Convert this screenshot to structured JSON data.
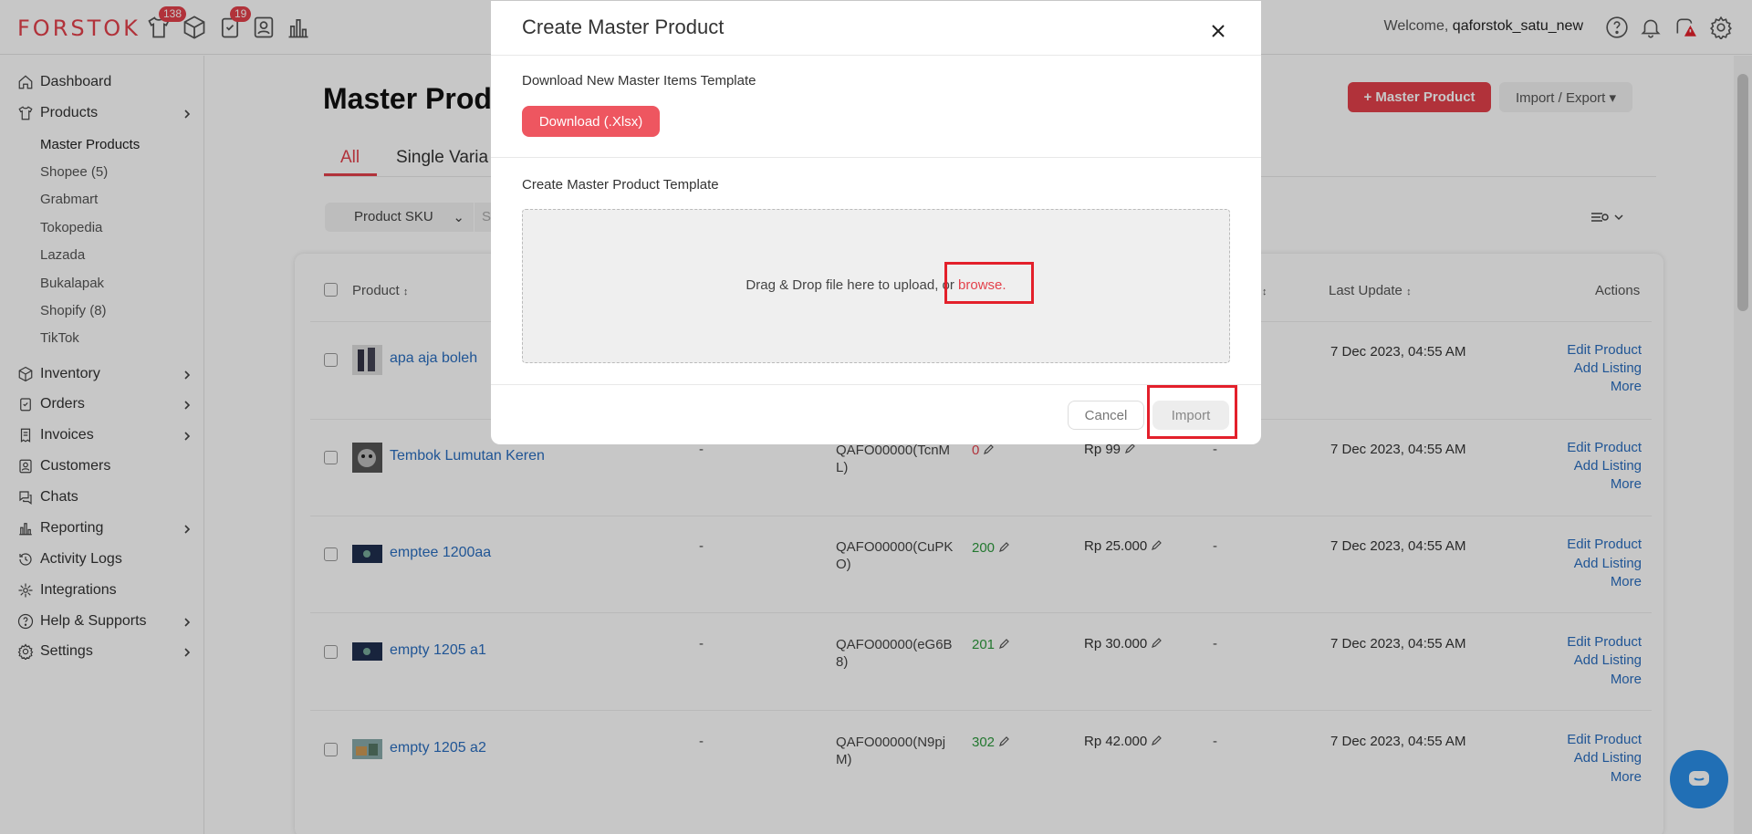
{
  "app": {
    "logo": "FORSTOK"
  },
  "topbar": {
    "badges": {
      "products": "138",
      "orders": "19"
    },
    "welcome_prefix": "Welcome, ",
    "username": "qaforstok_satu_new"
  },
  "sidebar": {
    "items": [
      {
        "label": "Dashboard",
        "icon": "home-icon"
      },
      {
        "label": "Products",
        "icon": "tshirt-icon"
      },
      {
        "label": "Inventory",
        "icon": "box-icon"
      },
      {
        "label": "Orders",
        "icon": "clipboard-icon"
      },
      {
        "label": "Invoices",
        "icon": "invoice-icon"
      },
      {
        "label": "Customers",
        "icon": "contact-icon"
      },
      {
        "label": "Chats",
        "icon": "chat-icon"
      },
      {
        "label": "Reporting",
        "icon": "bar-chart-icon"
      },
      {
        "label": "Activity Logs",
        "icon": "history-icon"
      },
      {
        "label": "Integrations",
        "icon": "integration-icon"
      },
      {
        "label": "Help & Supports",
        "icon": "help-icon"
      },
      {
        "label": "Settings",
        "icon": "gear-icon"
      }
    ],
    "product_subitems": [
      "Master Products",
      "Shopee (5)",
      "Grabmart",
      "Tokopedia",
      "Lazada",
      "Bukalapak",
      "Shopify (8)",
      "TikTok"
    ]
  },
  "main": {
    "title": "Master Produ",
    "add_button": "+ Master Product",
    "import_export": "Import / Export",
    "tabs": [
      "All",
      "Single Varia"
    ],
    "filter_select": "Product SKU",
    "search_placeholder": "S",
    "columns": {
      "product": "Product",
      "last_update": "Last Update",
      "actions": "Actions"
    },
    "actions": {
      "edit": "Edit Product",
      "add": "Add Listing",
      "more": "More"
    },
    "rows": [
      {
        "name": "apa aja boleh",
        "dash1": "",
        "sku_line1": "",
        "sku_line2": "",
        "stock": "",
        "price": "",
        "dash2": "",
        "date": "7 Dec 2023, 04:55 AM"
      },
      {
        "name": "Tembok Lumutan Keren",
        "dash1": "-",
        "sku_line1": "QAFO00000(TcnM",
        "sku_line2": "L)",
        "stock": "0",
        "price": "Rp 99",
        "dash2": "-",
        "date": "7 Dec 2023, 04:55 AM"
      },
      {
        "name": "emptee 1200aa",
        "dash1": "-",
        "sku_line1": "QAFO00000(CuPK",
        "sku_line2": "O)",
        "stock": "200",
        "price": "Rp 25.000",
        "dash2": "-",
        "date": "7 Dec 2023, 04:55 AM"
      },
      {
        "name": "empty 1205 a1",
        "dash1": "-",
        "sku_line1": "QAFO00000(eG6B",
        "sku_line2": "8)",
        "stock": "201",
        "price": "Rp 30.000",
        "dash2": "-",
        "date": "7 Dec 2023, 04:55 AM"
      },
      {
        "name": "empty 1205 a2",
        "dash1": "-",
        "sku_line1": "QAFO00000(N9pj",
        "sku_line2": "M)",
        "stock": "302",
        "price": "Rp 42.000",
        "dash2": "-",
        "date": "7 Dec 2023, 04:55 AM"
      }
    ]
  },
  "modal": {
    "title": "Create Master Product",
    "download_label": "Download New Master Items Template",
    "download_button": "Download (.Xlsx)",
    "template_label": "Create Master Product Template",
    "dropzone_text": "Drag & Drop file here to upload, or ",
    "browse": "browse.",
    "cancel": "Cancel",
    "import": "Import"
  },
  "colors": {
    "brand": "#e3414b",
    "link": "#2a6ebf",
    "stock_ok": "#2e9a3e",
    "stock_zero": "#e3414b",
    "highlight": "#e3202b"
  }
}
